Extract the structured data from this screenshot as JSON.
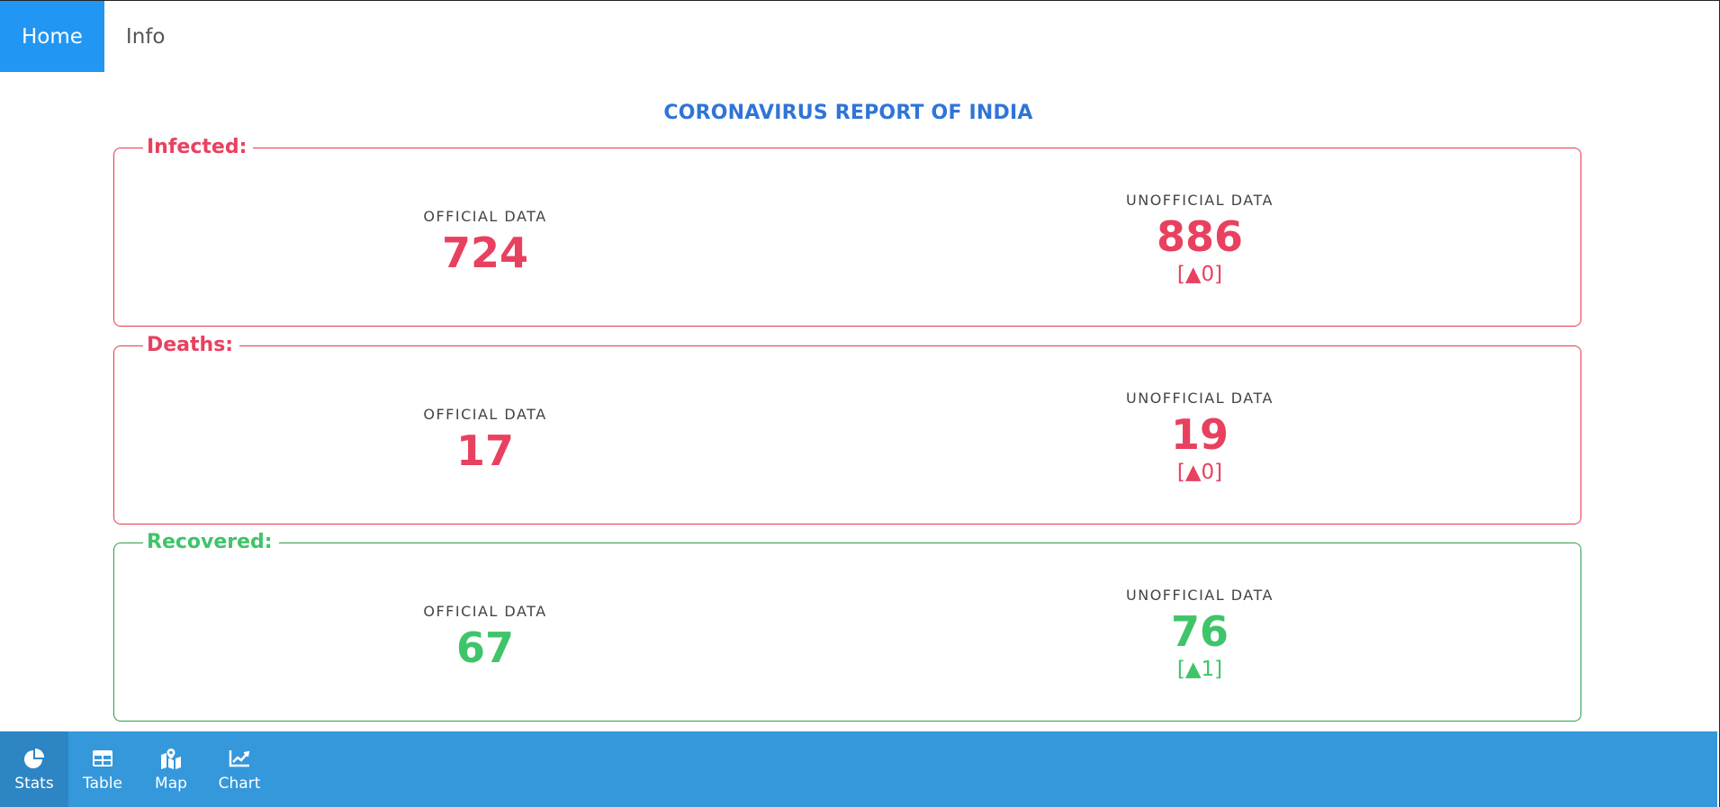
{
  "topnav": {
    "tabs": [
      {
        "label": "Home",
        "active": true
      },
      {
        "label": "Info",
        "active": false
      }
    ]
  },
  "report": {
    "title": "CORONAVIRUS REPORT OF INDIA",
    "sections": [
      {
        "name": "Infected:",
        "official_label": "OFFICIAL DATA",
        "official_value": "724",
        "unofficial_label": "UNOFFICIAL DATA",
        "unofficial_value": "886",
        "unofficial_delta": "[▲0]",
        "color": "#e8415f"
      },
      {
        "name": "Deaths:",
        "official_label": "OFFICIAL DATA",
        "official_value": "17",
        "unofficial_label": "UNOFFICIAL DATA",
        "unofficial_value": "19",
        "unofficial_delta": "[▲0]",
        "color": "#e8415f"
      },
      {
        "name": "Recovered:",
        "official_label": "OFFICIAL DATA",
        "official_value": "67",
        "unofficial_label": "UNOFFICIAL DATA",
        "unofficial_value": "76",
        "unofficial_delta": "[▲1]",
        "color": "#3fc46a"
      }
    ]
  },
  "bottomnav": {
    "items": [
      {
        "label": "Stats",
        "icon": "pie-chart-icon",
        "active": true
      },
      {
        "label": "Table",
        "icon": "table-icon",
        "active": false
      },
      {
        "label": "Map",
        "icon": "map-icon",
        "active": false
      },
      {
        "label": "Chart",
        "icon": "line-chart-icon",
        "active": false
      }
    ]
  },
  "colors": {
    "accent": "#2196f3",
    "bottom_bar": "#3498db",
    "title": "#2f74d8",
    "red": "#e8415f",
    "green": "#3fc46a"
  }
}
